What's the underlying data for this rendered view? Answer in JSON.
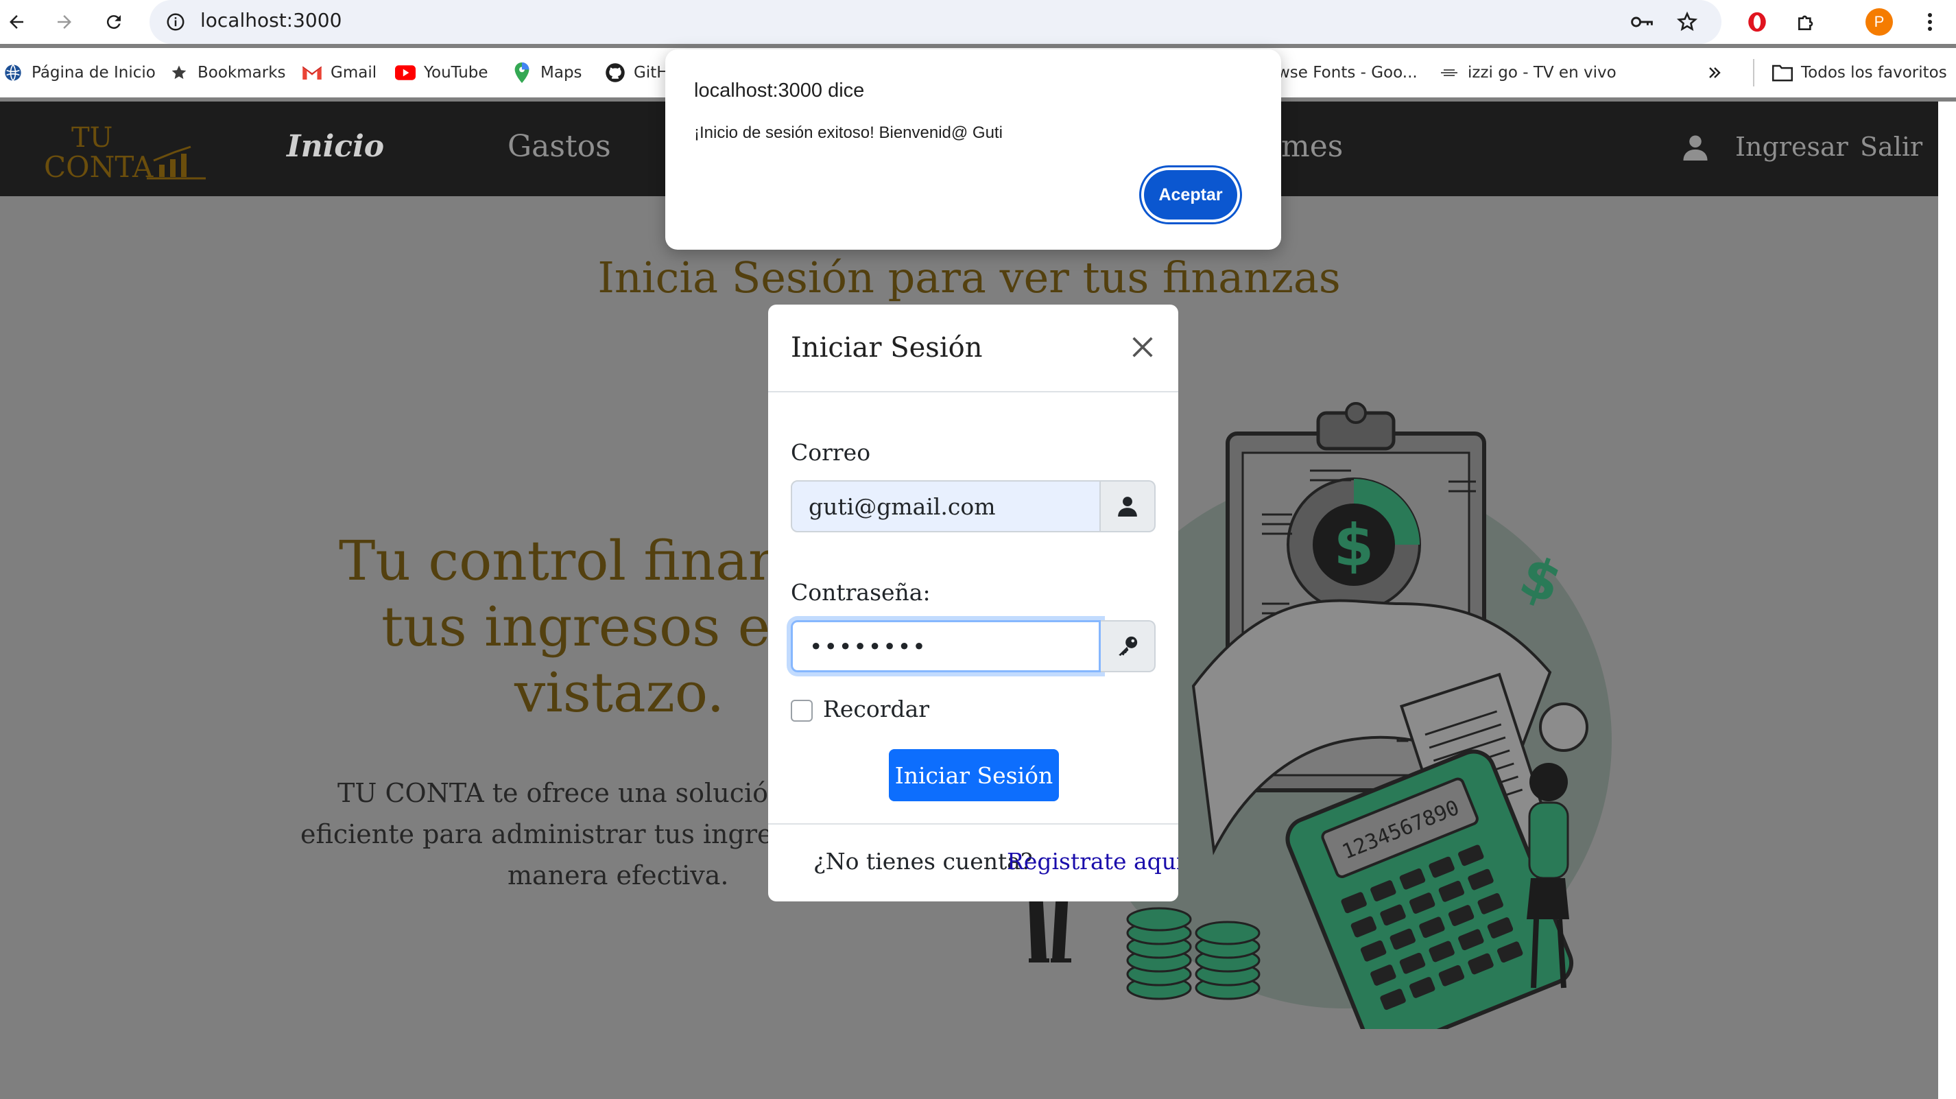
{
  "browser": {
    "url": "localhost:3000",
    "bookmarks": [
      {
        "label": "Página de Inicio",
        "icon": "globe-icon"
      },
      {
        "label": "Bookmarks",
        "icon": "star-icon"
      },
      {
        "label": "Gmail",
        "icon": "gmail-icon"
      },
      {
        "label": "YouTube",
        "icon": "youtube-icon"
      },
      {
        "label": "Maps",
        "icon": "maps-pin-icon"
      },
      {
        "label": "GitH",
        "icon": "github-icon"
      },
      {
        "label": "wse Fonts - Goo...",
        "icon": ""
      },
      {
        "label": "izzi go - TV en vivo",
        "icon": "izzi-icon"
      }
    ],
    "all_bookmarks_label": "Todos los favoritos",
    "profile_initial": "P"
  },
  "navbar": {
    "logo_line1": "TU",
    "logo_line2": "CONTA",
    "links": [
      "Inicio",
      "Gastos",
      "mes"
    ],
    "login_label": "Ingresar",
    "logout_label": "Salir"
  },
  "page": {
    "heading": "Inicia Sesión para ver tus finanzas",
    "hero_line1": "Tu control financ",
    "hero_line2": "tus ingresos en",
    "hero_line3": "vistazo.",
    "desc_line1": "TU CONTA te ofrece una solución in",
    "desc_line2": "eficiente para administrar tus ingresos",
    "desc_line3": "manera efectiva.",
    "illustration_text": "1234567890"
  },
  "login_modal": {
    "title": "Iniciar Sesión",
    "email_label": "Correo",
    "email_value": "guti@gmail.com",
    "password_label": "Contraseña:",
    "password_value": "••••••••",
    "remember_label": "Recordar",
    "submit_label": "Iniciar Sesión",
    "no_account_text": "¿No tienes cuenta?",
    "register_link": "Registrate aqui"
  },
  "alert": {
    "title": "localhost:3000 dice",
    "message": "¡Inicio de sesión exitoso! Bienvenid@ Guti",
    "ok_label": "Aceptar"
  },
  "colors": {
    "brand_gold": "#53400f",
    "navbar_bg": "#1c1c1c",
    "primary_blue": "#0d6efd",
    "accent_green": "#2a7a57",
    "overlay": "#7f7f7f"
  }
}
